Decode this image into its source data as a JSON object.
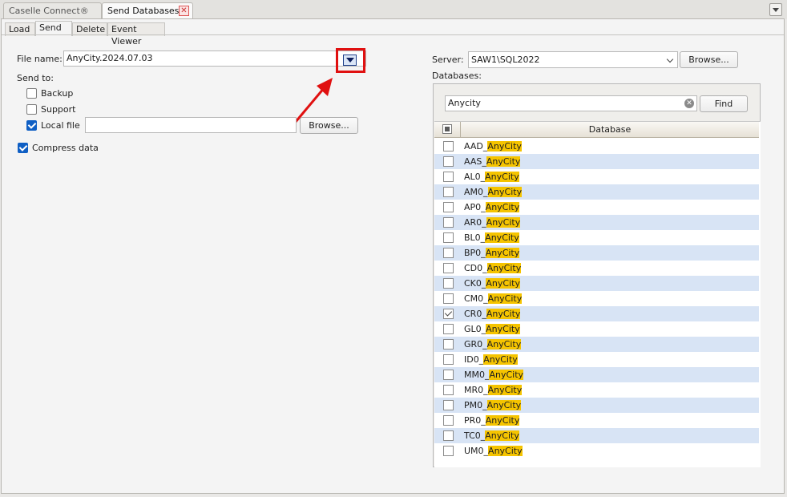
{
  "doc_tabs": [
    {
      "label": "Caselle Connect®"
    },
    {
      "label": "Send Databases"
    }
  ],
  "sub_tabs": [
    {
      "label": "Load"
    },
    {
      "label": "Send"
    },
    {
      "label": "Delete"
    },
    {
      "label": "Event Viewer"
    }
  ],
  "form": {
    "file_name_label": "File name:",
    "file_name_value": "AnyCity.2024.07.03",
    "send_to_label": "Send to:",
    "backup_label": "Backup",
    "support_label": "Support",
    "local_file_label": "Local file",
    "local_file_value": "",
    "browse_label": "Browse...",
    "compress_label": "Compress data"
  },
  "server": {
    "label": "Server:",
    "value": "SAW1\\SQL2022",
    "browse_label": "Browse...",
    "databases_label": "Databases:"
  },
  "search": {
    "value": "Anycity",
    "find_label": "Find"
  },
  "grid": {
    "header": "Database",
    "rows": [
      {
        "prefix": "AAD_",
        "match": "AnyCity",
        "checked": false
      },
      {
        "prefix": "AAS_",
        "match": "AnyCity",
        "checked": false
      },
      {
        "prefix": "AL0_",
        "match": "AnyCity",
        "checked": false
      },
      {
        "prefix": "AM0_",
        "match": "AnyCity",
        "checked": false
      },
      {
        "prefix": "AP0_",
        "match": "AnyCity",
        "checked": false
      },
      {
        "prefix": "AR0_",
        "match": "AnyCity",
        "checked": false
      },
      {
        "prefix": "BL0_",
        "match": "AnyCity",
        "checked": false
      },
      {
        "prefix": "BP0_",
        "match": "AnyCity",
        "checked": false
      },
      {
        "prefix": "CD0_",
        "match": "AnyCity",
        "checked": false
      },
      {
        "prefix": "CK0_",
        "match": "AnyCity",
        "checked": false
      },
      {
        "prefix": "CM0_",
        "match": "AnyCity",
        "checked": false
      },
      {
        "prefix": "CR0_",
        "match": "AnyCity",
        "checked": true
      },
      {
        "prefix": "GL0_",
        "match": "AnyCity",
        "checked": false
      },
      {
        "prefix": "GR0_",
        "match": "AnyCity",
        "checked": false
      },
      {
        "prefix": "ID0_",
        "match": "AnyCity",
        "checked": false
      },
      {
        "prefix": "MM0_",
        "match": "AnyCity",
        "checked": false
      },
      {
        "prefix": "MR0_",
        "match": "AnyCity",
        "checked": false
      },
      {
        "prefix": "PM0_",
        "match": "AnyCity",
        "checked": false
      },
      {
        "prefix": "PR0_",
        "match": "AnyCity",
        "checked": false
      },
      {
        "prefix": "TC0_",
        "match": "AnyCity",
        "checked": false
      },
      {
        "prefix": "UM0_",
        "match": "AnyCity",
        "checked": false
      }
    ]
  },
  "colors": {
    "highlight": "#f5c400",
    "row_alt": "#d8e4f5",
    "annotation_red": "#e01010",
    "checkbox_blue": "#0f5fc4"
  }
}
